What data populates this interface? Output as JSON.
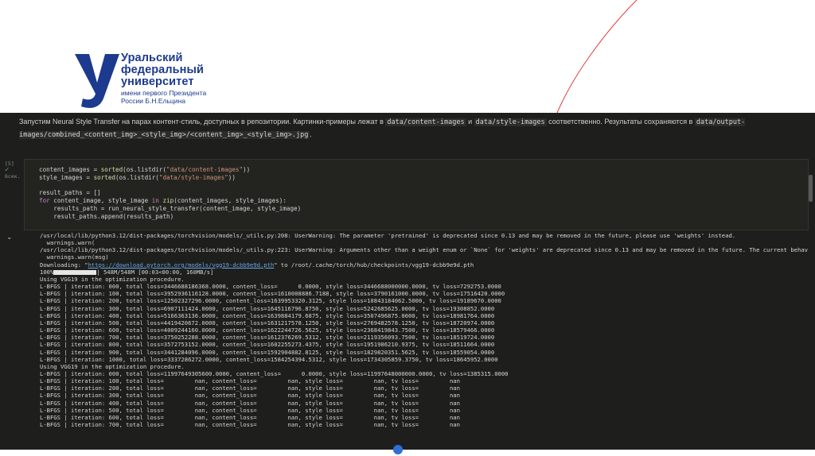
{
  "colors": {
    "brand": "#1c3a8e",
    "accent_arc": "#e03a3a",
    "notebook_bg": "#1e1f1c"
  },
  "logo": {
    "line1": "Уральский",
    "line2": "федеральный",
    "line3": "университет",
    "line4": "имени первого Президента",
    "line5": "России Б.Н.Ельцина"
  },
  "markdown": {
    "part1": "Запустим Neural Style Transfer на парах контент-стиль, доступных в репозитории. Картинки-примеры лежат в ",
    "code1": "data/content-images",
    "part2": " и ",
    "code2": "data/style-images",
    "part3": " соответственно. Результаты сохраняются в ",
    "code3": "data/output-images/combined_<content_img>_<style_img>/<content_img>_<style_img>.jpg",
    "part4": "."
  },
  "cell": {
    "exec_count": "[5]",
    "exec_time": "6сек."
  },
  "code": {
    "l1a": "content_images = ",
    "l1b": "sorted",
    "l1c": "(os.listdir(",
    "l1d": "\"data/content-images\"",
    "l1e": "))",
    "l2a": "style_images = ",
    "l2b": "sorted",
    "l2c": "(os.listdir(",
    "l2d": "\"data/style-images\"",
    "l2e": "))",
    "l3": "result_paths = []",
    "l4a": "for",
    "l4b": " content_image, style_image ",
    "l4c": "in",
    "l4d": " zip",
    "l4e": "(content_images, style_images):",
    "l5": "    results_path = run_neural_style_transfer(content_image, style_image)",
    "l6": "    result_paths.append(results_path)"
  },
  "output": {
    "warn1": "/usr/local/lib/python3.12/dist-packages/torchvision/models/_utils.py:208: UserWarning: The parameter 'pretrained' is deprecated since 0.13 and may be removed in the future, please use 'weights' instead.",
    "warn1b": "  warnings.warn(",
    "warn2": "/usr/local/lib/python3.12/dist-packages/torchvision/models/_utils.py:223: UserWarning: Arguments other than a weight enum or `None` for 'weights' are deprecated since 0.13 and may be removed in the future. The current behav",
    "warn2b": "  warnings.warn(msg)",
    "download_prefix": "Downloading: \"",
    "download_link": "https://download.pytorch.org/models/vgg19-dcbb9e9d.pth",
    "download_suffix": "\" to /root/.cache/torch/hub/checkpoints/vgg19-dcbb9e9d.pth",
    "progress_pct": "100%",
    "progress_text": "| 548M/548M [00:03<00:00, 160MB/s]",
    "using1": "Using VGG19 in the optimization procedure.",
    "run1": [
      "L-BFGS | iteration: 000, total loss=3446688186368.0000, content_loss=      0.0000, style loss=3446688000000.0000, tv loss=7292753.0000",
      "L-BFGS | iteration: 100, total loss=3952936116128.0000, content_loss=1610008886.7188, style loss=3790161000.0000, tv loss=17516420.0000",
      "L-BFGS | iteration: 200, total loss=12502327296.0000, content_loss=1639953320.3125, style loss=10843184062.5000, tv loss=19189670.0000",
      "L-BFGS | iteration: 300, total loss=6907111424.0000, content_loss=1645116796.8750, style loss=5242685625.0000, tv loss=19308852.0000",
      "L-BFGS | iteration: 400, total loss=5166363136.0000, content_loss=1639884179.6875, style loss=3507496875.0000, tv loss=18981764.0000",
      "L-BFGS | iteration: 500, total loss=4419420672.0000, content_loss=1631217578.1250, style loss=2769482578.1250, tv loss=18720974.0000",
      "L-BFGS | iteration: 600, total loss=4009244160.0000, content_loss=1622244726.5625, style loss=2368419843.7500, tv loss=18579466.0000",
      "L-BFGS | iteration: 700, total loss=3750252288.0000, content_loss=1612376269.5312, style loss=2119356093.7500, tv loss=18519724.0000",
      "L-BFGS | iteration: 800, total loss=3572753152.0000, content_loss=1602255273.4375, style loss=1951986210.9375, tv loss=18511664.0000",
      "L-BFGS | iteration: 900, total loss=3441284096.0000, content_loss=1592904882.8125, style loss=1829820351.5625, tv loss=18559054.0000",
      "L-BFGS | iteration: 1000, total loss=3337286272.0000, content_loss=1584254394.5312, style loss=1734305859.3750, tv loss=18645952.0000"
    ],
    "using2": "Using VGG19 in the optimization procedure.",
    "run2": [
      "L-BFGS | iteration: 000, total loss=11997649305600.0000, content_loss=      0.0000, style loss=11997648000000.0000, tv loss=1385315.0000",
      "L-BFGS | iteration: 100, total loss=         nan, content_loss=         nan, style loss=         nan, tv loss=         nan",
      "L-BFGS | iteration: 200, total loss=         nan, content_loss=         nan, style loss=         nan, tv loss=         nan",
      "L-BFGS | iteration: 300, total loss=         nan, content_loss=         nan, style loss=         nan, tv loss=         nan",
      "L-BFGS | iteration: 400, total loss=         nan, content_loss=         nan, style loss=         nan, tv loss=         nan",
      "L-BFGS | iteration: 500, total loss=         nan, content_loss=         nan, style loss=         nan, tv loss=         nan",
      "L-BFGS | iteration: 600, total loss=         nan, content_loss=         nan, style loss=         nan, tv loss=         nan",
      "L-BFGS | iteration: 700, total loss=         nan, content_loss=         nan, style loss=         nan, tv loss=         nan"
    ]
  }
}
